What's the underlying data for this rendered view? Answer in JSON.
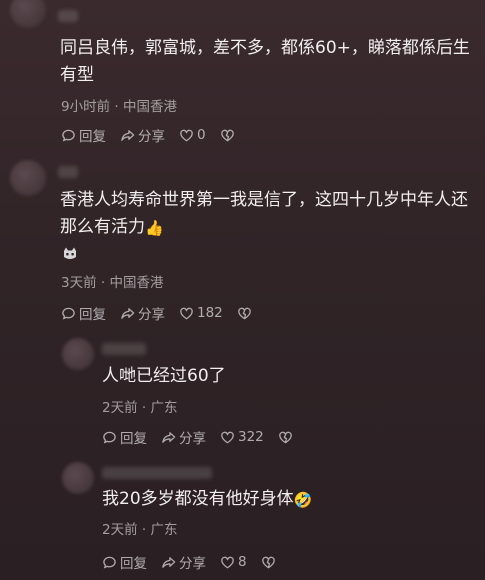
{
  "comments": [
    {
      "text_line1": "同吕良伟，郭富城，差不多，都係60+，睇落都係后生",
      "text_line2": "有型",
      "meta": "9小时前 · 中国香港",
      "reply_label": "回复",
      "share_label": "分享",
      "likes": "0"
    },
    {
      "text_line1": "香港人均寿命世界第一我是信了，这四十几岁中年人还",
      "text_line2": "那么有活力",
      "emoji": "👍",
      "meta": "3天前 · 中国香港",
      "reply_label": "回复",
      "share_label": "分享",
      "likes": "182"
    }
  ],
  "replies": [
    {
      "text": "人哋已经过60了",
      "meta": "2天前 · 广东",
      "reply_label": "回复",
      "share_label": "分享",
      "likes": "322"
    },
    {
      "text": "我20多岁都没有他好身体",
      "emoji": "🤣",
      "meta": "2天前 · 广东",
      "reply_label": "回复",
      "share_label": "分享",
      "likes": "8"
    }
  ],
  "icons": [
    "comment-bubble-icon",
    "share-arrow-icon",
    "heart-icon",
    "broken-heart-icon"
  ]
}
